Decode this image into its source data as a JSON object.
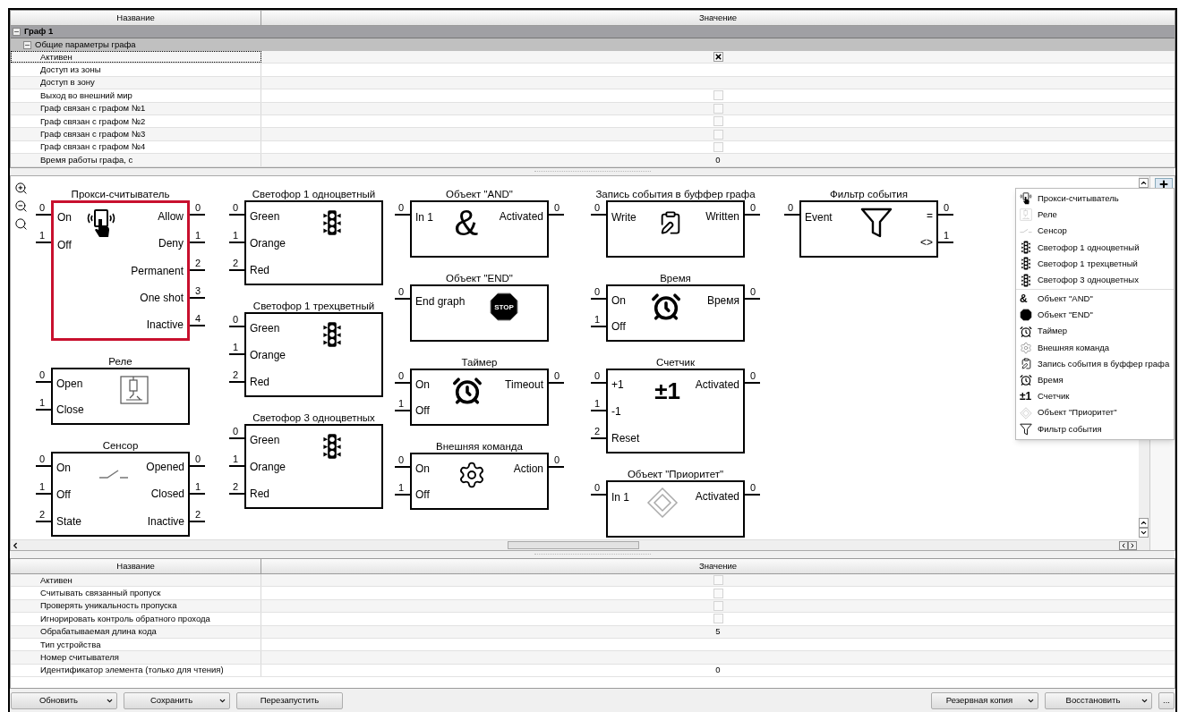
{
  "top_table": {
    "columns": [
      "Название",
      "Значение"
    ],
    "group": {
      "title": "Граф 1",
      "expanded": true
    },
    "subgroup": {
      "title": "Общие параметры графа",
      "expanded": true
    },
    "rows": [
      {
        "name": "Активен",
        "kind": "checkbox",
        "checked": true,
        "selected": true
      },
      {
        "name": "Доступ из зоны",
        "kind": "empty",
        "selected": false
      },
      {
        "name": "Доступ в зону",
        "kind": "empty",
        "selected": false
      },
      {
        "name": "Выход во внешний мир",
        "kind": "checkbox",
        "checked": false,
        "selected": false
      },
      {
        "name": "Граф связан с графом №1",
        "kind": "checkbox",
        "checked": false,
        "selected": false
      },
      {
        "name": "Граф связан с графом №2",
        "kind": "checkbox",
        "checked": false,
        "selected": false
      },
      {
        "name": "Граф связан с графом №3",
        "kind": "checkbox",
        "checked": false,
        "selected": false
      },
      {
        "name": "Граф связан с графом №4",
        "kind": "checkbox",
        "checked": false,
        "selected": false
      },
      {
        "name": "Время работы графа, с",
        "kind": "text",
        "value": "0",
        "selected": false
      }
    ]
  },
  "canvas": {
    "columns": [
      [
        {
          "title": "Прокси-считыватель",
          "kind": "proxy",
          "selected": true,
          "inputs": [
            {
              "num": "0",
              "label": "On"
            },
            {
              "num": "1",
              "label": "Off"
            }
          ],
          "outputs": [
            {
              "num": "0",
              "label": "Allow"
            },
            {
              "num": "1",
              "label": "Deny"
            },
            {
              "num": "2",
              "label": "Permanent"
            },
            {
              "num": "3",
              "label": "One shot"
            },
            {
              "num": "4",
              "label": "Inactive"
            }
          ]
        },
        {
          "title": "Реле",
          "kind": "relay",
          "selected": false,
          "inputs": [
            {
              "num": "0",
              "label": "Open"
            },
            {
              "num": "1",
              "label": "Close"
            }
          ]
        },
        {
          "title": "Сенсор",
          "kind": "sensor",
          "selected": false,
          "inputs": [
            {
              "num": "0",
              "label": "On"
            },
            {
              "num": "1",
              "label": "Off"
            },
            {
              "num": "2",
              "label": "State"
            }
          ],
          "outputs": [
            {
              "num": "0",
              "label": "Opened"
            },
            {
              "num": "1",
              "label": "Closed"
            },
            {
              "num": "2",
              "label": "Inactive"
            }
          ]
        }
      ],
      [
        {
          "title": "Светофор 1 одноцветный",
          "kind": "traffic",
          "selected": false,
          "inputs": [
            {
              "num": "0",
              "label": "Green"
            },
            {
              "num": "1",
              "label": "Orange"
            },
            {
              "num": "2",
              "label": "Red"
            }
          ]
        },
        {
          "title": "Светофор 1 трехцветный",
          "kind": "traffic",
          "selected": false,
          "inputs": [
            {
              "num": "0",
              "label": "Green"
            },
            {
              "num": "1",
              "label": "Orange"
            },
            {
              "num": "2",
              "label": "Red"
            }
          ]
        },
        {
          "title": "Светофор 3 одноцветных",
          "kind": "traffic",
          "selected": false,
          "inputs": [
            {
              "num": "0",
              "label": "Green"
            },
            {
              "num": "1",
              "label": "Orange"
            },
            {
              "num": "2",
              "label": "Red"
            }
          ]
        }
      ],
      [
        {
          "title": "Объект \"AND\"",
          "kind": "symbol",
          "symbol": "&",
          "selected": false,
          "inputs": [
            {
              "num": "0",
              "label": "In 1"
            }
          ],
          "outputs": [
            {
              "num": "0",
              "label": "Activated"
            }
          ]
        },
        {
          "title": "Объект \"END\"",
          "kind": "stop",
          "stop_label": "STOP",
          "selected": false,
          "inputs": [
            {
              "num": "0",
              "label": "End graph"
            }
          ]
        },
        {
          "title": "Таймер",
          "kind": "alarm",
          "selected": false,
          "inputs": [
            {
              "num": "0",
              "label": "On"
            },
            {
              "num": "1",
              "label": "Off"
            }
          ],
          "outputs": [
            {
              "num": "0",
              "label": "Timeout"
            }
          ]
        },
        {
          "title": "Внешняя команда",
          "kind": "gear",
          "selected": false,
          "inputs": [
            {
              "num": "0",
              "label": "On"
            },
            {
              "num": "1",
              "label": "Off"
            }
          ],
          "outputs": [
            {
              "num": "0",
              "label": "Action"
            }
          ]
        }
      ],
      [
        {
          "title": "Запись события в буффер графа",
          "kind": "clipboard",
          "selected": false,
          "inputs": [
            {
              "num": "0",
              "label": "Write"
            }
          ],
          "outputs": [
            {
              "num": "0",
              "label": "Written"
            }
          ]
        },
        {
          "title": "Время",
          "kind": "alarm",
          "selected": false,
          "inputs": [
            {
              "num": "0",
              "label": "On"
            },
            {
              "num": "1",
              "label": "Off"
            }
          ],
          "outputs": [
            {
              "num": "0",
              "label": "Время"
            }
          ]
        },
        {
          "title": "Счетчик",
          "kind": "symbol",
          "symbol": "±1",
          "selected": false,
          "inputs": [
            {
              "num": "0",
              "label": "+1"
            },
            {
              "num": "1",
              "label": "-1"
            },
            {
              "num": "2",
              "label": "Reset"
            }
          ],
          "outputs": [
            {
              "num": "0",
              "label": "Activated"
            }
          ]
        },
        {
          "title": "Объект \"Приоритет\"",
          "kind": "diamond",
          "selected": false,
          "inputs": [
            {
              "num": "0",
              "label": "In 1"
            }
          ],
          "outputs": [
            {
              "num": "0",
              "label": "Activated"
            }
          ]
        }
      ],
      [
        {
          "title": "Фильтр события",
          "kind": "filter",
          "selected": false,
          "inputs": [
            {
              "num": "0",
              "label": "Event"
            }
          ],
          "outputs": [
            {
              "num": "0",
              "label": "="
            },
            {
              "num": "1",
              "label": "<>"
            }
          ]
        }
      ]
    ],
    "add_menu": {
      "groups": [
        [
          {
            "label": "Прокси-считыватель",
            "kind": "proxy"
          },
          {
            "label": "Реле",
            "kind": "relay"
          },
          {
            "label": "Сенсор",
            "kind": "sensor"
          },
          {
            "label": "Светофор 1 одноцветный",
            "kind": "traffic"
          },
          {
            "label": "Светофор 1 трехцветный",
            "kind": "traffic"
          },
          {
            "label": "Светофор 3 одноцветных",
            "kind": "traffic"
          }
        ],
        [
          {
            "label": "Объект \"AND\"",
            "kind": "symbol",
            "symbol": "&"
          },
          {
            "label": "Объект \"END\"",
            "kind": "stop"
          },
          {
            "label": "Таймер",
            "kind": "alarm"
          },
          {
            "label": "Внешняя команда",
            "kind": "gear"
          },
          {
            "label": "Запись события в буффер графа",
            "kind": "clipboard"
          },
          {
            "label": "Время",
            "kind": "alarm"
          },
          {
            "label": "Счетчик",
            "kind": "symbol",
            "symbol": "±1"
          },
          {
            "label": "Объект \"Приоритет\"",
            "kind": "diamond"
          },
          {
            "label": "Фильтр события",
            "kind": "filter"
          }
        ]
      ]
    }
  },
  "bottom_table": {
    "columns": [
      "Название",
      "Значение"
    ],
    "rows": [
      {
        "name": "Активен",
        "kind": "checkbox",
        "checked": false
      },
      {
        "name": "Считывать связанный пропуск",
        "kind": "checkbox",
        "checked": false
      },
      {
        "name": "Проверять уникальность пропуска",
        "kind": "checkbox",
        "checked": false
      },
      {
        "name": "Игнорировать контроль обратного прохода",
        "kind": "checkbox",
        "checked": false
      },
      {
        "name": "Обрабатываемая длина кода",
        "kind": "text",
        "value": "5"
      },
      {
        "name": "Тип устройства",
        "kind": "empty"
      },
      {
        "name": "Номер считывателя",
        "kind": "empty"
      },
      {
        "name": "Идентификатор элемента (только для чтения)",
        "kind": "text",
        "value": "0"
      }
    ]
  },
  "buttons_left": [
    {
      "label": "Обновить",
      "dropdown": true
    },
    {
      "label": "Сохранить",
      "dropdown": true
    },
    {
      "label": "Перезапустить",
      "dropdown": false
    }
  ],
  "buttons_right": [
    {
      "label": "Резервная копия",
      "dropdown": true
    },
    {
      "label": "Восстановить",
      "dropdown": true
    },
    {
      "label": "...",
      "dropdown": false
    }
  ]
}
